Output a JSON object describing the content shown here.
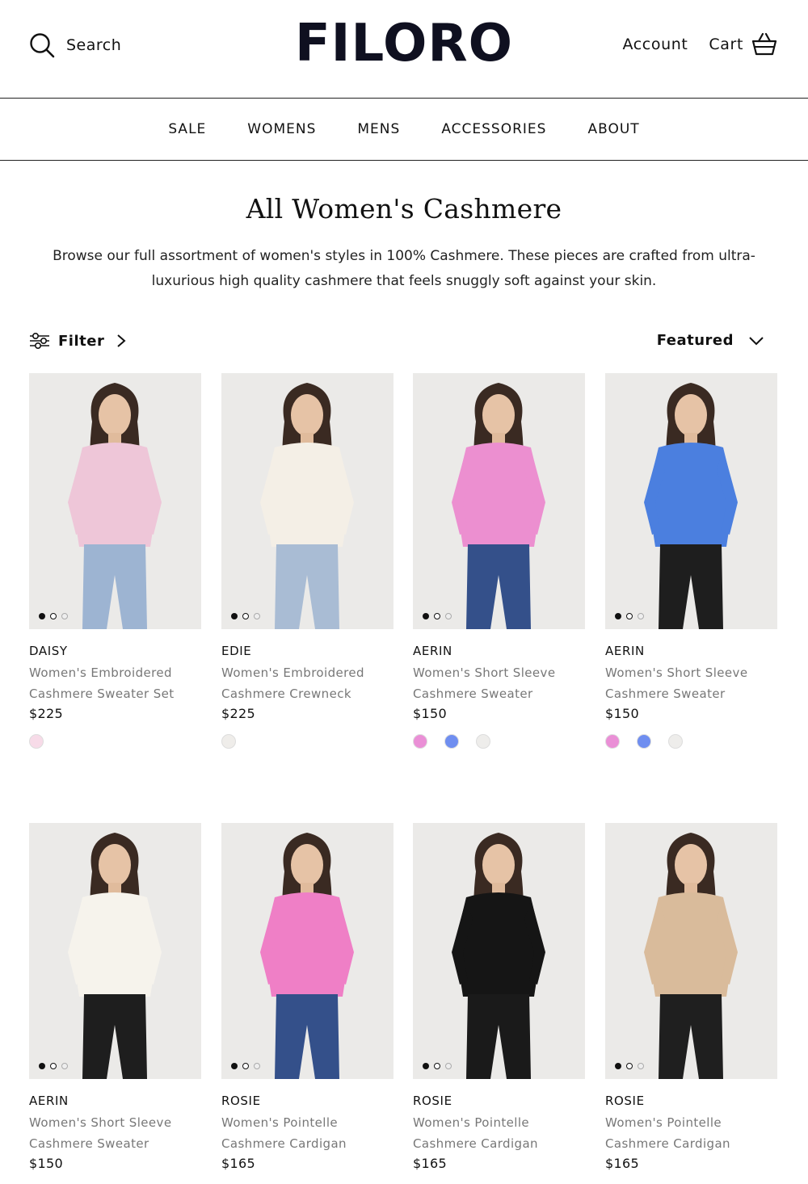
{
  "header": {
    "search_label": "Search",
    "logo": "FILORO",
    "account_label": "Account",
    "cart_label": "Cart"
  },
  "nav": [
    "SALE",
    "WOMENS",
    "MENS",
    "ACCESSORIES",
    "ABOUT"
  ],
  "page": {
    "title": "All Women's Cashmere",
    "description": "Browse our full assortment of women's styles in 100% Cashmere. These pieces are crafted from ultra-luxurious high quality cashmere that feels snuggly soft against your skin."
  },
  "toolbar": {
    "filter_label": "Filter",
    "sort_label": "Featured"
  },
  "products": [
    {
      "brand": "DAISY",
      "name": "Women's Embroidered Cashmere Sweater Set",
      "price": "$225",
      "top_color": "#eec6d8",
      "bottom_color": "#9db4d2",
      "swatches": [
        "#f7dbe8"
      ]
    },
    {
      "brand": "EDIE",
      "name": "Women's Embroidered Cashmere Crewneck",
      "price": "$225",
      "top_color": "#f4efe6",
      "bottom_color": "#a9bcd4",
      "swatches": [
        "#efedea"
      ]
    },
    {
      "brand": "AERIN",
      "name": "Women's Short Sleeve Cashmere Sweater",
      "price": "$150",
      "top_color": "#ec8fd0",
      "bottom_color": "#34508a",
      "swatches": [
        "#ea8fd6",
        "#6f8ef0",
        "#eeedeb"
      ]
    },
    {
      "brand": "AERIN",
      "name": "Women's Short Sleeve Cashmere Sweater",
      "price": "$150",
      "top_color": "#4b7fdf",
      "bottom_color": "#1e1e1e",
      "swatches": [
        "#ea8fd6",
        "#6f8ef0",
        "#eeedeb"
      ]
    },
    {
      "brand": "AERIN",
      "name": "Women's Short Sleeve Cashmere Sweater",
      "price": "$150",
      "top_color": "#f6f3ec",
      "bottom_color": "#1e1e1e",
      "swatches": []
    },
    {
      "brand": "ROSIE",
      "name": "Women's Pointelle Cashmere Cardigan",
      "price": "$165",
      "top_color": "#ef7fc6",
      "bottom_color": "#34508a",
      "swatches": []
    },
    {
      "brand": "ROSIE",
      "name": "Women's Pointelle Cashmere Cardigan",
      "price": "$165",
      "top_color": "#151515",
      "bottom_color": "#1a1a1a",
      "swatches": []
    },
    {
      "brand": "ROSIE",
      "name": "Women's Pointelle Cashmere Cardigan",
      "price": "$165",
      "top_color": "#d9bb9b",
      "bottom_color": "#1f1f1f",
      "swatches": []
    }
  ]
}
